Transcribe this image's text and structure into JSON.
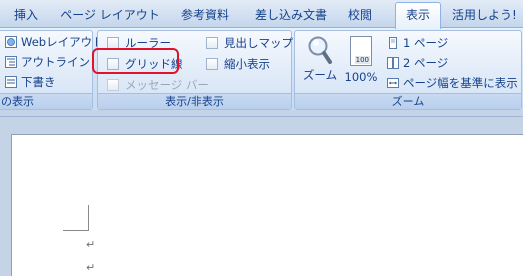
{
  "tabs": [
    {
      "label": "挿入"
    },
    {
      "label": "ページ レイアウト"
    },
    {
      "label": "参考資料"
    },
    {
      "label": "差し込み文書"
    },
    {
      "label": "校閲"
    },
    {
      "label": "表示",
      "active": true
    },
    {
      "label": "活用しよう!"
    }
  ],
  "views_group": {
    "items": [
      "Webレイアウト",
      "アウトライン",
      "下書き"
    ],
    "label": "の表示"
  },
  "show_hide_group": {
    "label": "表示/非表示",
    "checkboxes": [
      {
        "label": "ルーラー",
        "checked": false,
        "enabled": true
      },
      {
        "label": "グリッド線",
        "checked": false,
        "enabled": true,
        "highlighted": true
      },
      {
        "label": "メッセージ バー",
        "checked": false,
        "enabled": false
      },
      {
        "label": "見出しマップ",
        "checked": false,
        "enabled": true
      },
      {
        "label": "縮小表示",
        "checked": false,
        "enabled": true
      }
    ]
  },
  "zoom_group": {
    "label": "ズーム",
    "zoom_button": "ズーム",
    "percent_button": "100%",
    "percent_icon_text": "100",
    "items": [
      "1 ページ",
      "2 ページ",
      "ページ幅を基準に表示"
    ]
  },
  "document": {
    "paragraph_mark": "↵"
  },
  "colors": {
    "ribbon_text": "#15428b",
    "highlight": "#e0132b",
    "disabled_text": "#9aa7b8"
  }
}
